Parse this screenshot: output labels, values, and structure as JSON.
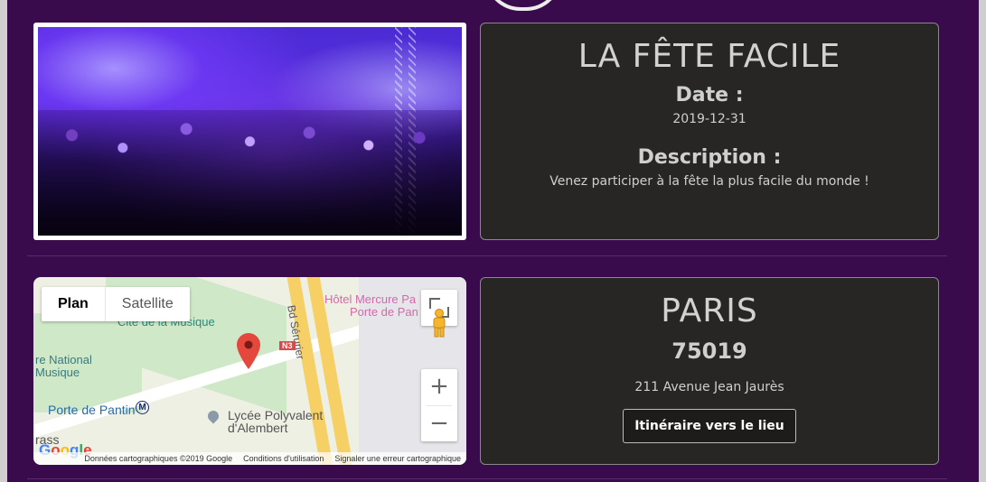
{
  "event": {
    "title": "LA FÊTE FACILE",
    "date_label": "Date :",
    "date_value": "2019-12-31",
    "description_label": "Description :",
    "description_value": "Venez participer à la fête la plus facile du monde !"
  },
  "location": {
    "city": "PARIS",
    "postal_code": "75019",
    "address": "211 Avenue Jean Jaurès",
    "directions_button": "Itinéraire vers le lieu"
  },
  "map": {
    "type_plan": "Plan",
    "type_satellite": "Satellite",
    "labels": {
      "hotel": "Hôtel Mercure Pa",
      "hotel2": "Porte de Pan",
      "cite": "Cité de la Musique",
      "national": "re National",
      "musique": "Musique",
      "boulevard": "Bd Sérurier",
      "n3": "N3",
      "porte_pantin": "Porte de Pantin",
      "metro_badge": "M",
      "lycee1": "Lycée Polyvalent",
      "lycee2": "d'Alembert",
      "rass": "rass"
    },
    "zoom_in": "+",
    "zoom_out": "−",
    "footer_data": "Données cartographiques ©2019 Google",
    "footer_terms": "Conditions d'utilisation",
    "footer_report": "Signaler une erreur cartographique",
    "google_logo": "Google"
  }
}
